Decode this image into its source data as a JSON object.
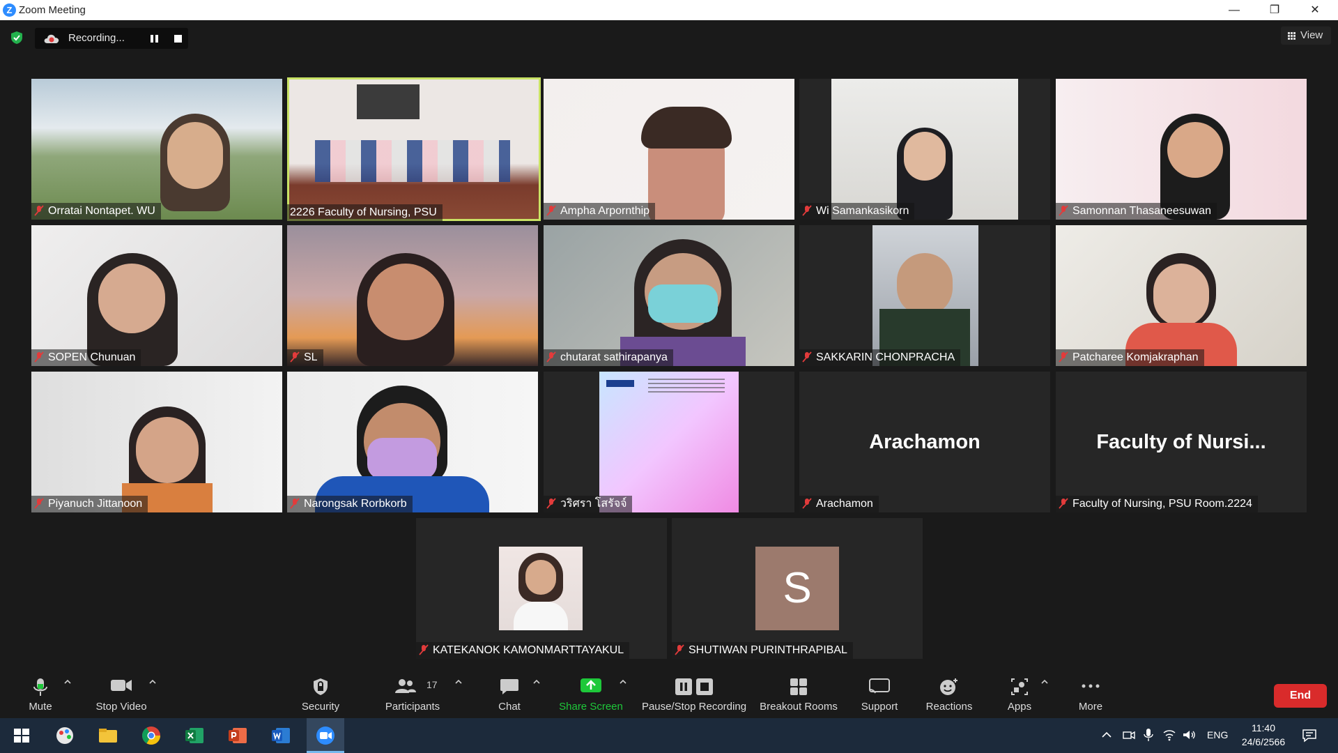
{
  "window": {
    "title": "Zoom Meeting",
    "minimize": "—",
    "restore": "❐",
    "close": "✕"
  },
  "recording": {
    "label": "Recording..."
  },
  "view": {
    "label": "View"
  },
  "participants_tiles": [
    {
      "name": "Orratai Nontapet. WU"
    },
    {
      "name": "2226 Faculty of Nursing, PSU"
    },
    {
      "name": "Ampha  Arpornthip"
    },
    {
      "name": "Wi Samankasikorn"
    },
    {
      "name": "Samonnan Thasaneesuwan"
    },
    {
      "name": "SOPEN Chunuan"
    },
    {
      "name": "SL"
    },
    {
      "name": "chutarat sathirapanya"
    },
    {
      "name": "SAKKARIN CHONPRACHA"
    },
    {
      "name": "Patcharee Komjakraphan"
    },
    {
      "name": "Piyanuch Jittanoon"
    },
    {
      "name": "Narongsak Rorbkorb"
    },
    {
      "name": "วริศรา โสรัจจ์"
    },
    {
      "name": "Arachamon",
      "big": "Arachamon"
    },
    {
      "name": "Faculty of Nursing, PSU Room.2224",
      "big": "Faculty of Nursi..."
    },
    {
      "name": "KATEKANOK KAMONMARTTAYAKUL"
    },
    {
      "name": "SHUTIWAN PURINTHRAPIBAL",
      "avatar_letter": "S"
    }
  ],
  "toolbar": {
    "mute": "Mute",
    "stop_video": "Stop Video",
    "security": "Security",
    "participants": "Participants",
    "participants_count": "17",
    "chat": "Chat",
    "share_screen": "Share Screen",
    "pause_stop": "Pause/Stop Recording",
    "breakout": "Breakout Rooms",
    "support": "Support",
    "reactions": "Reactions",
    "apps": "Apps",
    "more": "More",
    "end": "End"
  },
  "taskbar": {
    "lang": "ENG",
    "time": "11:40",
    "date": "24/6/2566"
  },
  "colors": {
    "active_speaker": "#c9e265",
    "share_green": "#1ec83a",
    "end_red": "#d92b2b",
    "mute_red": "#e23b3b"
  }
}
